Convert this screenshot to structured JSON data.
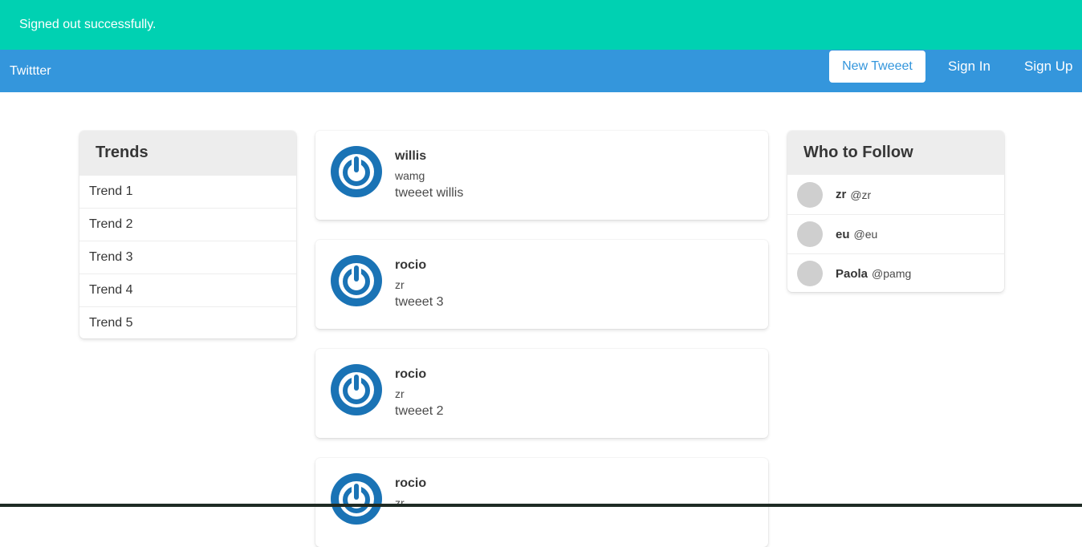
{
  "flash": {
    "message": "Signed out successfully."
  },
  "navbar": {
    "brand": "Twittter",
    "new_tweet": "New Tweeet",
    "sign_in": "Sign In",
    "sign_up": "Sign Up"
  },
  "trends": {
    "title": "Trends",
    "items": [
      "Trend 1",
      "Trend 2",
      "Trend 3",
      "Trend 4",
      "Trend 5"
    ]
  },
  "tweets": [
    {
      "user": "willis",
      "handle": "wamg",
      "text": "tweeet willis"
    },
    {
      "user": "rocio",
      "handle": "zr",
      "text": "tweeet 3"
    },
    {
      "user": "rocio",
      "handle": "zr",
      "text": "tweeet 2"
    },
    {
      "user": "rocio",
      "handle": "zr",
      "text": ""
    }
  ],
  "who_to_follow": {
    "title": "Who to Follow",
    "users": [
      {
        "name": "zr",
        "handle": "@zr"
      },
      {
        "name": "eu",
        "handle": "@eu"
      },
      {
        "name": "Paola",
        "handle": "@pamg"
      }
    ]
  },
  "colors": {
    "flash_bg": "#00d1b2",
    "navbar_bg": "#3496dc",
    "avatar_blue": "#1a73b5",
    "panel_heading_bg": "#ededed"
  },
  "icons": {
    "tweet_avatar": "power-icon",
    "follow_avatar": "avatar-placeholder-icon"
  }
}
